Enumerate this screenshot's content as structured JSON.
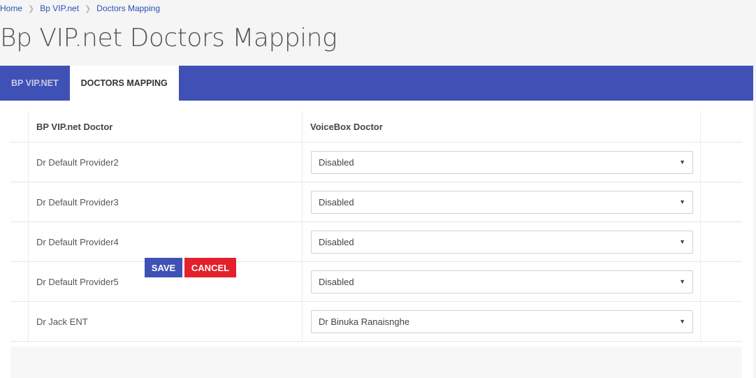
{
  "breadcrumb": {
    "home": "Home",
    "section": "Bp VIP.net",
    "current": "Doctors Mapping"
  },
  "page_title": "Bp VIP.net Doctors Mapping",
  "tabs": [
    {
      "label": "BP VIP.NET",
      "active": false
    },
    {
      "label": "DOCTORS MAPPING",
      "active": true
    }
  ],
  "table": {
    "headers": {
      "bp_doctor": "BP VIP.net Doctor",
      "voicebox_doctor": "VoiceBox Doctor"
    },
    "rows": [
      {
        "bp_doctor": "Dr Default Provider2",
        "voicebox_doctor": "Disabled"
      },
      {
        "bp_doctor": "Dr Default Provider3",
        "voicebox_doctor": "Disabled"
      },
      {
        "bp_doctor": "Dr Default Provider4",
        "voicebox_doctor": "Disabled"
      },
      {
        "bp_doctor": "Dr Default Provider5",
        "voicebox_doctor": "Disabled"
      },
      {
        "bp_doctor": "Dr Jack ENT",
        "voicebox_doctor": "Dr Binuka Ranaisnghe"
      }
    ]
  },
  "buttons": {
    "save": "SAVE",
    "cancel": "CANCEL"
  },
  "colors": {
    "accent": "#3f51b5",
    "danger": "#e3202b",
    "link": "#2b50b0"
  },
  "icons": {
    "breadcrumb_separator": "chevron-right-icon",
    "select_caret": "caret-down-icon"
  }
}
